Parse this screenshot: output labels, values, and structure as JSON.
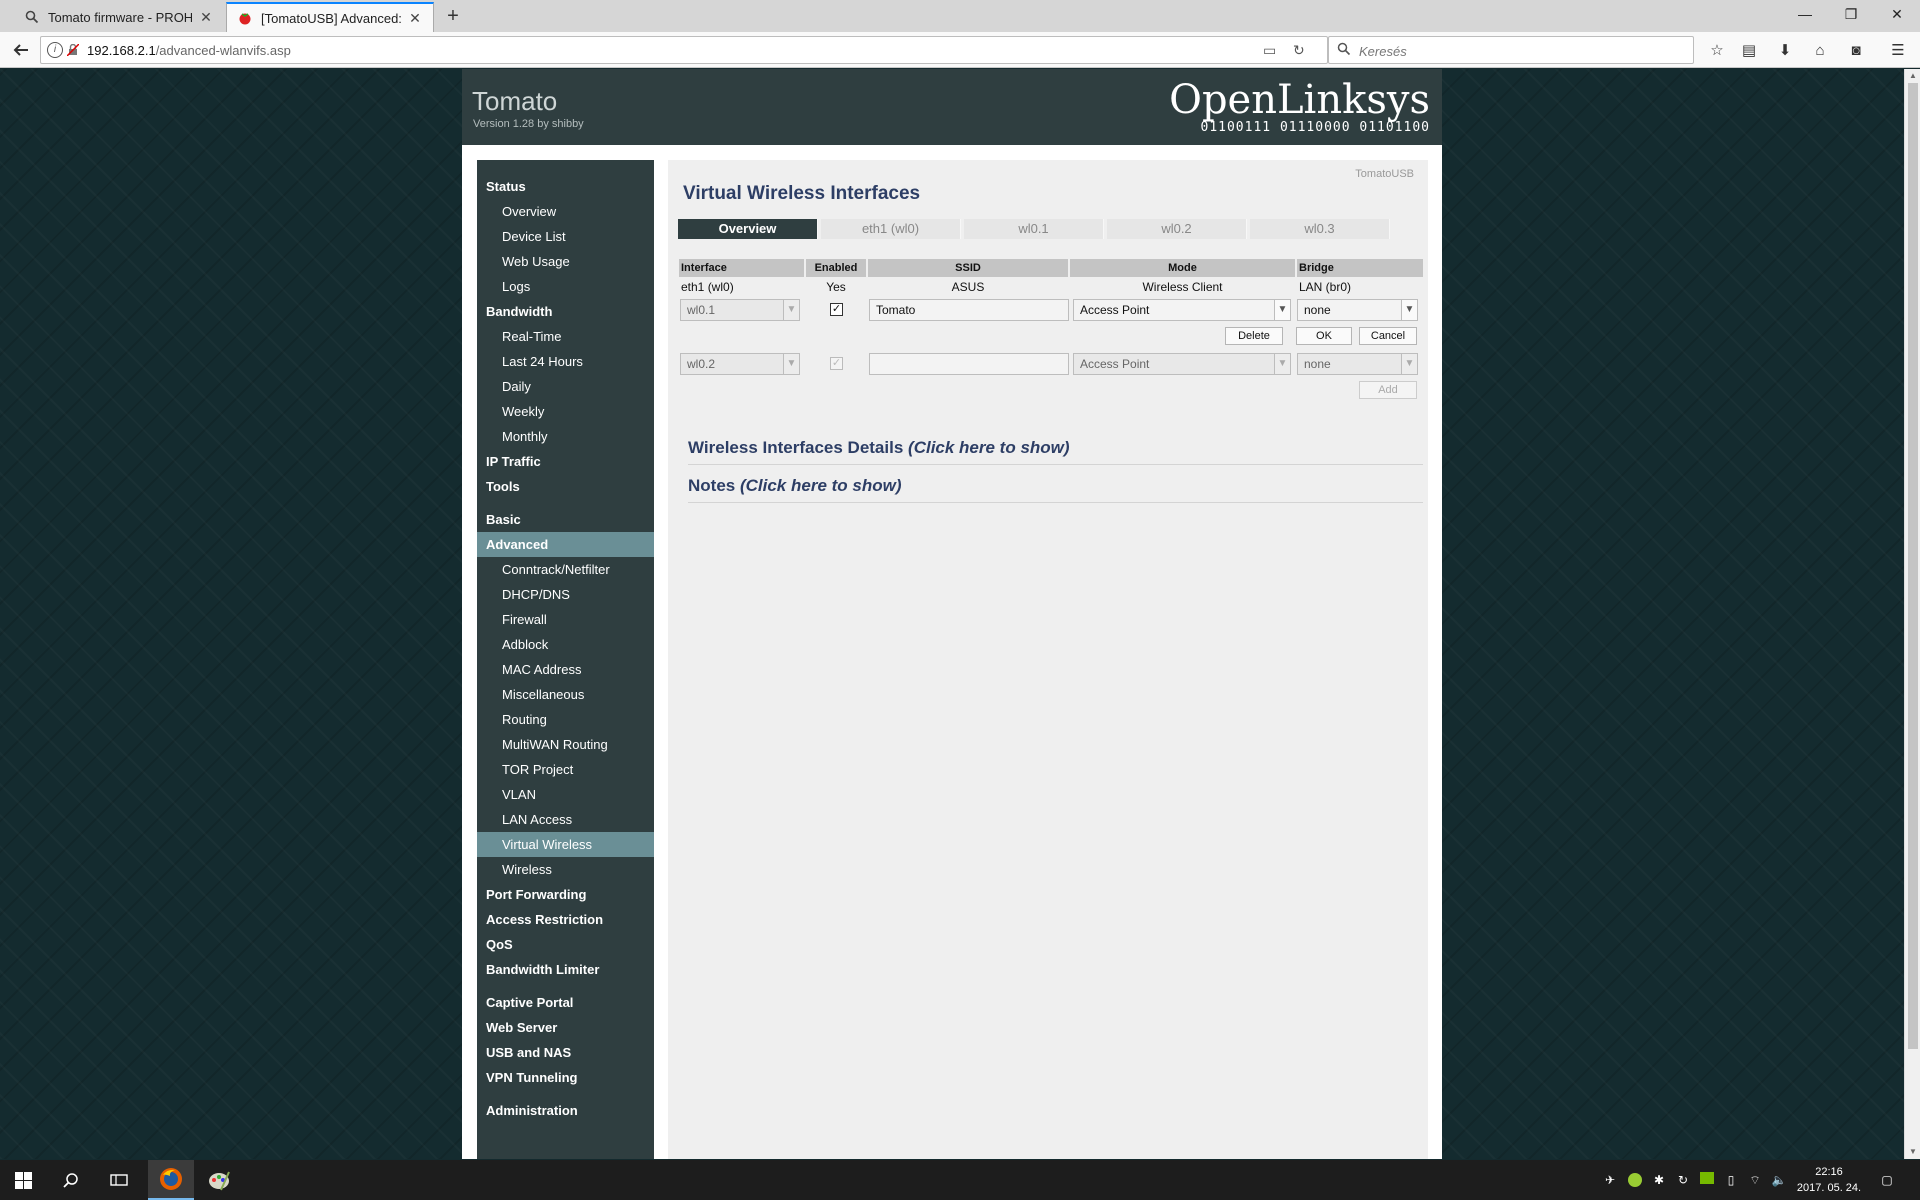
{
  "browser": {
    "tabs": [
      {
        "title": "Tomato firmware - PROHAR",
        "active": false
      },
      {
        "title": "[TomatoUSB] Advanced: Virt",
        "active": true
      }
    ],
    "url_host": "192.168.2.1",
    "url_path": "/advanced-wlanvifs.asp",
    "search_placeholder": "Keresés"
  },
  "router": {
    "brand": "Tomato",
    "version": "Version 1.28 by shibby",
    "logo_text": "OpenLinksys",
    "logo_bits": "01100111 01110000 01101100",
    "corner_label": "TomatoUSB"
  },
  "sidebar": {
    "items": [
      {
        "label": "Status",
        "type": "head"
      },
      {
        "label": "Overview",
        "type": "sub"
      },
      {
        "label": "Device List",
        "type": "sub"
      },
      {
        "label": "Web Usage",
        "type": "sub"
      },
      {
        "label": "Logs",
        "type": "sub"
      },
      {
        "label": "Bandwidth",
        "type": "head"
      },
      {
        "label": "Real-Time",
        "type": "sub"
      },
      {
        "label": "Last 24 Hours",
        "type": "sub"
      },
      {
        "label": "Daily",
        "type": "sub"
      },
      {
        "label": "Weekly",
        "type": "sub"
      },
      {
        "label": "Monthly",
        "type": "sub"
      },
      {
        "label": "IP Traffic",
        "type": "head"
      },
      {
        "label": "Tools",
        "type": "head"
      },
      {
        "label": "Basic",
        "type": "head"
      },
      {
        "label": "Advanced",
        "type": "head",
        "selected": true
      },
      {
        "label": "Conntrack/Netfilter",
        "type": "sub"
      },
      {
        "label": "DHCP/DNS",
        "type": "sub"
      },
      {
        "label": "Firewall",
        "type": "sub"
      },
      {
        "label": "Adblock",
        "type": "sub"
      },
      {
        "label": "MAC Address",
        "type": "sub"
      },
      {
        "label": "Miscellaneous",
        "type": "sub"
      },
      {
        "label": "Routing",
        "type": "sub"
      },
      {
        "label": "MultiWAN Routing",
        "type": "sub"
      },
      {
        "label": "TOR Project",
        "type": "sub"
      },
      {
        "label": "VLAN",
        "type": "sub"
      },
      {
        "label": "LAN Access",
        "type": "sub"
      },
      {
        "label": "Virtual Wireless",
        "type": "sub",
        "selected": true
      },
      {
        "label": "Wireless",
        "type": "sub"
      },
      {
        "label": "Port Forwarding",
        "type": "head"
      },
      {
        "label": "Access Restriction",
        "type": "head"
      },
      {
        "label": "QoS",
        "type": "head"
      },
      {
        "label": "Bandwidth Limiter",
        "type": "head"
      },
      {
        "label": "Captive Portal",
        "type": "head"
      },
      {
        "label": "Web Server",
        "type": "head"
      },
      {
        "label": "USB and NAS",
        "type": "head"
      },
      {
        "label": "VPN Tunneling",
        "type": "head"
      },
      {
        "label": "Administration",
        "type": "head"
      }
    ]
  },
  "content": {
    "title": "Virtual Wireless Interfaces",
    "tabs": [
      "Overview",
      "eth1 (wl0)",
      "wl0.1",
      "wl0.2",
      "wl0.3"
    ],
    "grid": {
      "headers": [
        "Interface",
        "Enabled",
        "SSID",
        "Mode",
        "Bridge"
      ],
      "static_row": {
        "interface": "eth1 (wl0)",
        "enabled": "Yes",
        "ssid": "ASUS",
        "mode": "Wireless Client",
        "bridge": "LAN (br0)"
      },
      "edit_row": {
        "interface": "wl0.1",
        "enabled": true,
        "ssid": "Tomato",
        "mode": "Access Point",
        "bridge": "none"
      },
      "edit_buttons": [
        "Delete",
        "OK",
        "Cancel"
      ],
      "new_row": {
        "interface": "wl0.2",
        "enabled": true,
        "ssid": "",
        "mode": "Access Point",
        "bridge": "none"
      },
      "add_button": "Add"
    },
    "sections": [
      {
        "title": "Wireless Interfaces Details",
        "link": "(Click here to show)"
      },
      {
        "title": "Notes",
        "link": "(Click here to show)"
      }
    ]
  },
  "taskbar": {
    "time": "22:16",
    "date": "2017. 05. 24."
  }
}
